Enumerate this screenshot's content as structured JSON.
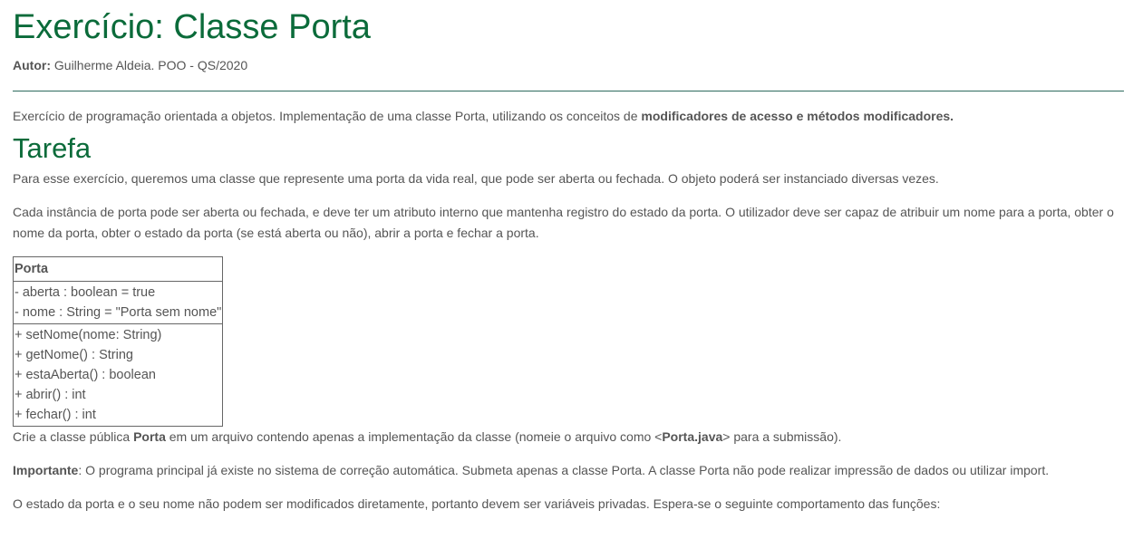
{
  "header": {
    "title": "Exercício: Classe Porta",
    "author_label": "Autor:",
    "author_value": "Guilherme Aldeia. POO - QS/2020"
  },
  "intro": {
    "text": "Exercício de programação orientada a objetos. Implementação de uma classe Porta, utilizando os conceitos de ",
    "bold": "modificadores de acesso e métodos modificadores."
  },
  "task": {
    "heading": "Tarefa",
    "para1": "Para esse exercício, queremos uma classe que represente uma porta da vida real, que pode ser aberta ou fechada. O objeto poderá ser instanciado diversas vezes.",
    "para2": "Cada instância de porta pode ser aberta ou fechada, e deve ter um atributo interno que mantenha registro do estado da porta. O utilizador deve ser capaz de atribuir um nome para a porta, obter o nome da porta, obter o estado da porta (se está aberta ou não), abrir a porta e fechar a porta."
  },
  "uml": {
    "class_name": "Porta",
    "attributes": [
      "- aberta : boolean = true",
      "- nome : String = \"Porta sem nome\""
    ],
    "methods": [
      "+ setNome(nome: String)",
      "+ getNome() : String",
      "+ estaAberta() : boolean",
      "+ abrir() : int",
      "+ fechar() : int"
    ]
  },
  "instructions": {
    "create_pre": "Crie a classe pública ",
    "create_bold": "Porta",
    "create_mid": " em um arquivo contendo apenas a implementação da classe (nomeie o arquivo como <",
    "create_file": "Porta.java",
    "create_post": "> para a submissão).",
    "important_label": "Importante",
    "important_text": ": O programa principal já existe no sistema de correção automática. Submeta apenas a classe Porta. A classe Porta não pode realizar impressão de dados ou utilizar import.",
    "state_text": "O estado da porta e o seu nome não podem ser modificados diretamente, portanto devem ser variáveis privadas. Espera-se o seguinte comportamento das funções:"
  }
}
